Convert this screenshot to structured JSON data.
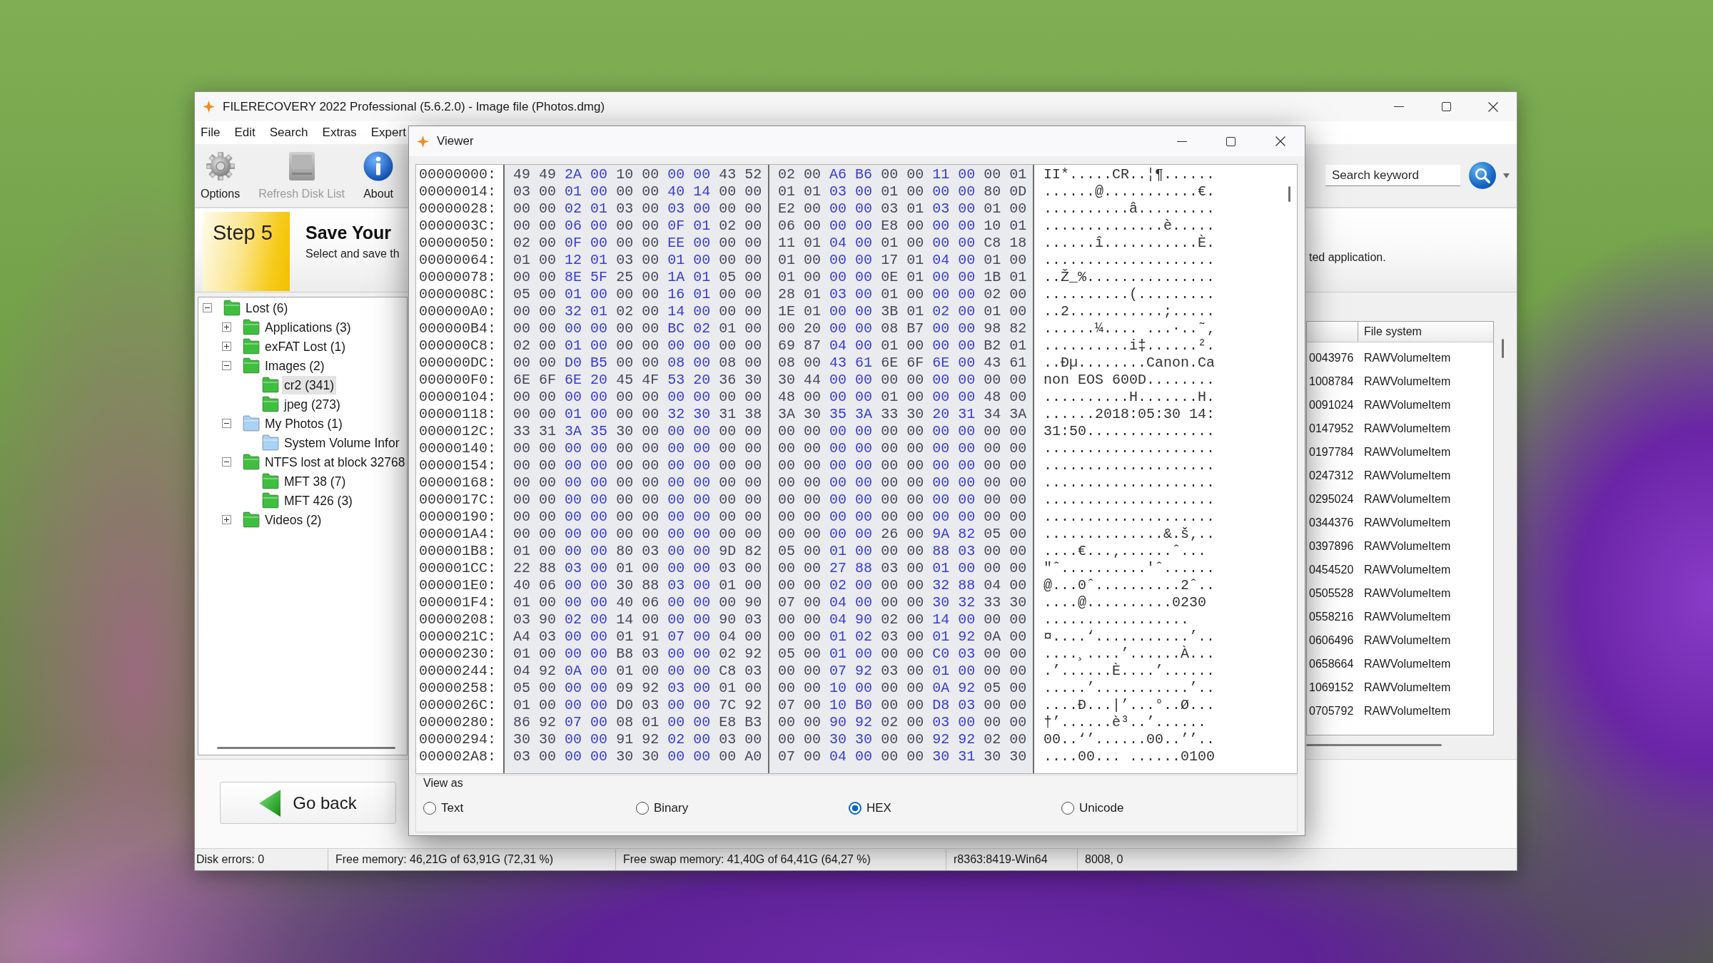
{
  "main_window": {
    "title": "FILERECOVERY 2022 Professional (5.6.2.0) - Image file (Photos.dmg)",
    "menu": [
      "File",
      "Edit",
      "Search",
      "Extras",
      "Expert"
    ],
    "toolbar": [
      {
        "kind": "options",
        "label": "Options",
        "disabled": false
      },
      {
        "kind": "refresh",
        "label": "Refresh Disk List",
        "disabled": true
      },
      {
        "kind": "about",
        "label": "About",
        "disabled": false
      }
    ],
    "search": {
      "placeholder": "Search keyword"
    },
    "step": {
      "badge": "Step 5",
      "title": "Save Your",
      "subtitle": "Select and save th",
      "subtitle_end": "ted application."
    },
    "tree": [
      {
        "label": "Lost (6)",
        "color": "#3fbf3f",
        "expanded": true,
        "selected": false,
        "children": [
          {
            "label": "Applications (3)",
            "color": "#3fbf3f",
            "expanded": false,
            "selected": false
          },
          {
            "label": "exFAT Lost (1)",
            "color": "#3fbf3f",
            "expanded": false,
            "selected": false
          },
          {
            "label": "Images (2)",
            "color": "#3fbf3f",
            "expanded": true,
            "selected": false,
            "children": [
              {
                "label": "cr2 (341)",
                "color": "#3fbf3f",
                "selected": true
              },
              {
                "label": "jpeg (273)",
                "color": "#3fbf3f",
                "selected": false
              }
            ]
          },
          {
            "label": "My Photos (1)",
            "color": "#a9d3f5",
            "expanded": true,
            "selected": false,
            "children": [
              {
                "label": "System Volume Infor",
                "color": "#a9d3f5",
                "selected": false
              }
            ]
          },
          {
            "label": "NTFS lost at block 32768",
            "color": "#3fbf3f",
            "expanded": true,
            "selected": false,
            "children": [
              {
                "label": "MFT 38 (7)",
                "color": "#3fbf3f",
                "selected": false
              },
              {
                "label": "MFT 426 (3)",
                "color": "#3fbf3f",
                "selected": false
              }
            ]
          },
          {
            "label": "Videos (2)",
            "color": "#3fbf3f",
            "expanded": false,
            "selected": false
          }
        ]
      }
    ],
    "results_table": {
      "heading": "File system",
      "rows": [
        {
          "column_1": "0043976",
          "file_system": "RAWVolumeItem"
        },
        {
          "column_1": "1008784",
          "file_system": "RAWVolumeItem"
        },
        {
          "column_1": "0091024",
          "file_system": "RAWVolumeItem"
        },
        {
          "column_1": "0147952",
          "file_system": "RAWVolumeItem"
        },
        {
          "column_1": "0197784",
          "file_system": "RAWVolumeItem"
        },
        {
          "column_1": "0247312",
          "file_system": "RAWVolumeItem"
        },
        {
          "column_1": "0295024",
          "file_system": "RAWVolumeItem"
        },
        {
          "column_1": "0344376",
          "file_system": "RAWVolumeItem"
        },
        {
          "column_1": "0397896",
          "file_system": "RAWVolumeItem"
        },
        {
          "column_1": "0454520",
          "file_system": "RAWVolumeItem"
        },
        {
          "column_1": "0505528",
          "file_system": "RAWVolumeItem"
        },
        {
          "column_1": "0558216",
          "file_system": "RAWVolumeItem"
        },
        {
          "column_1": "0606496",
          "file_system": "RAWVolumeItem"
        },
        {
          "column_1": "0658664",
          "file_system": "RAWVolumeItem"
        },
        {
          "column_1": "1069152",
          "file_system": "RAWVolumeItem"
        },
        {
          "column_1": "0705792",
          "file_system": "RAWVolumeItem"
        }
      ]
    },
    "go_back": "Go back",
    "status_bar": [
      "Disk errors: 0",
      "Free memory: 46,21G of 63,91G (72,31 %)",
      "Free swap memory: 41,40G of 64,41G (64,27 %)",
      "r8363:8419-Win64",
      "8008, 0"
    ]
  },
  "viewer": {
    "title": "Viewer",
    "rows": [
      {
        "offset": "00000000:",
        "hex_1": "49 49 2A 00 10 00 00 00 43 52",
        "hex_2": "02 00 A6 B6 00 00 11 00 00 01",
        "text": "II*.....CR..¦¶......"
      },
      {
        "offset": "00000014:",
        "hex_1": "03 00 01 00 00 00 40 14 00 00",
        "hex_2": "01 01 03 00 01 00 00 00 80 0D",
        "text": "......@...........€."
      },
      {
        "offset": "00000028:",
        "hex_1": "00 00 02 01 03 00 03 00 00 00",
        "hex_2": "E2 00 00 00 03 01 03 00 01 00",
        "text": "..........â........."
      },
      {
        "offset": "0000003C:",
        "hex_1": "00 00 06 00 00 00 0F 01 02 00",
        "hex_2": "06 00 00 00 E8 00 00 00 10 01",
        "text": "..............è....."
      },
      {
        "offset": "00000050:",
        "hex_1": "02 00 0F 00 00 00 EE 00 00 00",
        "hex_2": "11 01 04 00 01 00 00 00 C8 18",
        "text": "......î...........È."
      },
      {
        "offset": "00000064:",
        "hex_1": "01 00 12 01 03 00 01 00 00 00",
        "hex_2": "01 00 00 00 17 01 04 00 01 00",
        "text": "...................."
      },
      {
        "offset": "00000078:",
        "hex_1": "00 00 8E 5F 25 00 1A 01 05 00",
        "hex_2": "01 00 00 00 0E 01 00 00 1B 01",
        "text": "..Ž_%..............."
      },
      {
        "offset": "0000008C:",
        "hex_1": "05 00 01 00 00 00 16 01 00 00",
        "hex_2": "28 01 03 00 01 00 00 00 02 00",
        "text": "..........(........."
      },
      {
        "offset": "000000A0:",
        "hex_1": "00 00 32 01 02 00 14 00 00 00",
        "hex_2": "1E 01 00 00 3B 01 02 00 01 00",
        "text": "..2...........;....."
      },
      {
        "offset": "000000B4:",
        "hex_1": "00 00 00 00 00 00 BC 02 01 00",
        "hex_2": "00 20 00 00 08 B7 00 00 98 82",
        "text": "......¼.... ...·..˜‚"
      },
      {
        "offset": "000000C8:",
        "hex_1": "02 00 01 00 00 00 00 00 00 00",
        "hex_2": "69 87 04 00 01 00 00 00 B2 01",
        "text": "..........i‡......²."
      },
      {
        "offset": "000000DC:",
        "hex_1": "00 00 D0 B5 00 00 08 00 08 00",
        "hex_2": "08 00 43 61 6E 6F 6E 00 43 61",
        "text": "..Ðµ........Canon.Ca"
      },
      {
        "offset": "000000F0:",
        "hex_1": "6E 6F 6E 20 45 4F 53 20 36 30",
        "hex_2": "30 44 00 00 00 00 00 00 00 00",
        "text": "non EOS 600D........"
      },
      {
        "offset": "00000104:",
        "hex_1": "00 00 00 00 00 00 00 00 00 00",
        "hex_2": "48 00 00 00 01 00 00 00 48 00",
        "text": "..........H.......H."
      },
      {
        "offset": "00000118:",
        "hex_1": "00 00 01 00 00 00 32 30 31 38",
        "hex_2": "3A 30 35 3A 33 30 20 31 34 3A",
        "text": "......2018:05:30 14:"
      },
      {
        "offset": "0000012C:",
        "hex_1": "33 31 3A 35 30 00 00 00 00 00",
        "hex_2": "00 00 00 00 00 00 00 00 00 00",
        "text": "31:50..............."
      },
      {
        "offset": "00000140:",
        "hex_1": "00 00 00 00 00 00 00 00 00 00",
        "hex_2": "00 00 00 00 00 00 00 00 00 00",
        "text": "...................."
      },
      {
        "offset": "00000154:",
        "hex_1": "00 00 00 00 00 00 00 00 00 00",
        "hex_2": "00 00 00 00 00 00 00 00 00 00",
        "text": "...................."
      },
      {
        "offset": "00000168:",
        "hex_1": "00 00 00 00 00 00 00 00 00 00",
        "hex_2": "00 00 00 00 00 00 00 00 00 00",
        "text": "...................."
      },
      {
        "offset": "0000017C:",
        "hex_1": "00 00 00 00 00 00 00 00 00 00",
        "hex_2": "00 00 00 00 00 00 00 00 00 00",
        "text": "...................."
      },
      {
        "offset": "00000190:",
        "hex_1": "00 00 00 00 00 00 00 00 00 00",
        "hex_2": "00 00 00 00 00 00 00 00 00 00",
        "text": "...................."
      },
      {
        "offset": "000001A4:",
        "hex_1": "00 00 00 00 00 00 00 00 00 00",
        "hex_2": "00 00 00 00 26 00 9A 82 05 00",
        "text": "..............&.š‚.."
      },
      {
        "offset": "000001B8:",
        "hex_1": "01 00 00 00 80 03 00 00 9D 82",
        "hex_2": "05 00 01 00 00 00 88 03 00 00",
        "text": "....€...‚......ˆ..."
      },
      {
        "offset": "000001CC:",
        "hex_1": "22 88 03 00 01 00 00 00 03 00",
        "hex_2": "00 00 27 88 03 00 01 00 00 00",
        "text": "\"ˆ..........'ˆ......"
      },
      {
        "offset": "000001E0:",
        "hex_1": "40 06 00 00 30 88 03 00 01 00",
        "hex_2": "00 00 02 00 00 00 32 88 04 00",
        "text": "@...0ˆ..........2ˆ.."
      },
      {
        "offset": "000001F4:",
        "hex_1": "01 00 00 00 40 06 00 00 00 90",
        "hex_2": "07 00 04 00 00 00 30 32 33 30",
        "text": "....@..........0230"
      },
      {
        "offset": "00000208:",
        "hex_1": "03 90 02 00 14 00 00 00 90 03",
        "hex_2": "00 00 04 90 02 00 14 00 00 00",
        "text": "................."
      },
      {
        "offset": "0000021C:",
        "hex_1": "A4 03 00 00 01 91 07 00 04 00",
        "hex_2": "00 00 01 02 03 00 01 92 0A 00",
        "text": "¤....‘...........’.."
      },
      {
        "offset": "00000230:",
        "hex_1": "01 00 00 00 B8 03 00 00 02 92",
        "hex_2": "05 00 01 00 00 00 C0 03 00 00",
        "text": "....¸....’......À..."
      },
      {
        "offset": "00000244:",
        "hex_1": "04 92 0A 00 01 00 00 00 C8 03",
        "hex_2": "00 00 07 92 03 00 01 00 00 00",
        "text": ".’......È....’......"
      },
      {
        "offset": "00000258:",
        "hex_1": "05 00 00 00 09 92 03 00 01 00",
        "hex_2": "00 00 10 00 00 00 0A 92 05 00",
        "text": ".....’...........’.."
      },
      {
        "offset": "0000026C:",
        "hex_1": "01 00 00 00 D0 03 00 00 7C 92",
        "hex_2": "07 00 10 B0 00 00 D8 03 00 00",
        "text": "....Ð...|’...°..Ø..."
      },
      {
        "offset": "00000280:",
        "hex_1": "86 92 07 00 08 01 00 00 E8 B3",
        "hex_2": "00 00 90 92 02 00 03 00 00 00",
        "text": "†’......è³..’......"
      },
      {
        "offset": "00000294:",
        "hex_1": "30 30 00 00 91 92 02 00 03 00",
        "hex_2": "00 00 30 30 00 00 92 92 02 00",
        "text": "00..‘’......00..’’.."
      },
      {
        "offset": "000002A8:",
        "hex_1": "03 00 00 00 30 30 00 00 00 A0",
        "hex_2": "07 00 04 00 00 00 30 31 30 30",
        "text": "....00... ......0100"
      }
    ],
    "view_as": {
      "label": "View as",
      "options": [
        {
          "label": "Text",
          "selected": false
        },
        {
          "label": "Binary",
          "selected": false
        },
        {
          "label": "HEX",
          "selected": true
        },
        {
          "label": "Unicode",
          "selected": false
        }
      ]
    }
  }
}
